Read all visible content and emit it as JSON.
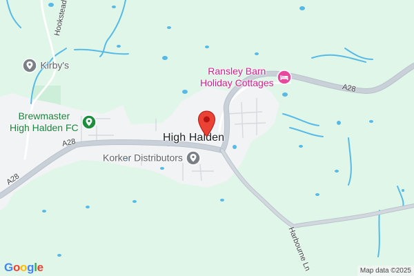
{
  "map": {
    "place_label": "High Halden",
    "pois": {
      "kirbys": "Kirby's",
      "brewmaster_line1": "Brewmaster",
      "brewmaster_line2": "High Halden FC",
      "ransley_line1": "Ransley Barn",
      "ransley_line2": "Holiday Cottages",
      "korker": "Korker Distributors"
    },
    "roads": {
      "a28_west": "A28",
      "a28_mid": "A28",
      "a28_east": "A28",
      "hookstead": "Hookstead",
      "harbourne": "Harbourne Ln"
    },
    "branding": {
      "logo_letters": [
        "G",
        "o",
        "o",
        "g",
        "l",
        "e"
      ],
      "attribution": "Map data ©2025"
    },
    "colors": {
      "land": "#dff6e8",
      "settlement": "#f1f3f4",
      "water": "#56b9e6",
      "road": "#c5cdd6",
      "pin": "#ea4335",
      "poi_grey": "#5f6368",
      "poi_green": "#188038",
      "poi_pink": "#d81b8c",
      "logo": [
        "#4285f4",
        "#ea4335",
        "#fbbc05",
        "#4285f4",
        "#34a853",
        "#ea4335"
      ]
    },
    "icons": {
      "pin": "map-pin-icon",
      "kirbys": "location-pin-icon",
      "brewmaster": "location-pin-icon",
      "ransley": "bed-icon",
      "korker": "location-pin-icon"
    }
  }
}
